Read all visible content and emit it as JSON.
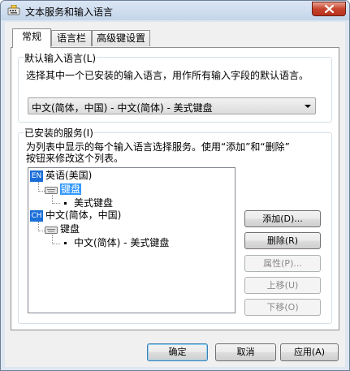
{
  "window": {
    "title": "文本服务和输入语言"
  },
  "tabs": [
    {
      "label": "常规",
      "active": true
    },
    {
      "label": "语言栏",
      "active": false
    },
    {
      "label": "高级键设置",
      "active": false
    }
  ],
  "default_language": {
    "group_label": "默认输入语言(L)",
    "description": "选择其中一个已安装的输入语言，用作所有输入字段的默认语言。",
    "selected": "中文(简体，中国) - 中文(简体) - 美式键盘"
  },
  "installed_services": {
    "group_label": "已安装的服务(I)",
    "description_line1": "为列表中显示的每个输入语言选择服务。使用“添加”和“删除”",
    "description_line2": "按钮来修改这个列表。",
    "tree": {
      "lang1": {
        "badge": "EN",
        "label": "英语(美国)"
      },
      "lang1_category": "键盘",
      "lang1_service": "美式键盘",
      "lang2": {
        "badge": "CH",
        "label": "中文(简体，中国)"
      },
      "lang2_category": "键盘",
      "lang2_service": "中文(简体) - 美式键盘"
    },
    "buttons": {
      "add": "添加(D)...",
      "remove": "删除(R)",
      "properties": "属性(P)...",
      "move_up": "上移(U)",
      "move_down": "下移(O)"
    }
  },
  "footer": {
    "ok": "确定",
    "cancel": "取消",
    "apply": "应用(A)"
  }
}
